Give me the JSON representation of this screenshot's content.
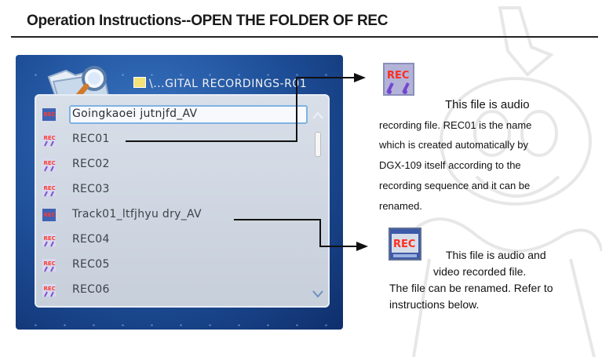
{
  "heading": "Operation Instructions--OPEN THE FOLDER OF REC",
  "device_screen": {
    "path": "\\...GITAL RECORDINGS-R01",
    "files": [
      {
        "name": "Goingkaoei jutnjfd_AV",
        "type": "video",
        "selected": true
      },
      {
        "name": "REC01",
        "type": "audio"
      },
      {
        "name": "REC02",
        "type": "audio"
      },
      {
        "name": "REC03",
        "type": "audio"
      },
      {
        "name": "Track01_ltfjhyu dry_AV",
        "type": "video"
      },
      {
        "name": "REC04",
        "type": "audio"
      },
      {
        "name": "REC05",
        "type": "audio"
      },
      {
        "name": "REC06",
        "type": "audio"
      }
    ]
  },
  "callouts": {
    "audio": {
      "icon": "rec-audio-icon",
      "line1": "This file is audio",
      "line2": "recording file.  REC01  is  the name",
      "line3": "which is created automatically by",
      "line4": "DGX-109      itself according to the",
      "line5": "recording sequence and  it can be",
      "line6": "renamed."
    },
    "video": {
      "icon": "rec-video-icon",
      "line1": "This file is audio and",
      "line2": "video recorded file.",
      "line3": "The file can be renamed. Refer to",
      "line4": "instructions below."
    }
  },
  "colors": {
    "screen_blue": "#1d4d96",
    "list_bg": "#d8dfe9",
    "selection_border": "#7fb2e3",
    "arrow": "#111111"
  }
}
